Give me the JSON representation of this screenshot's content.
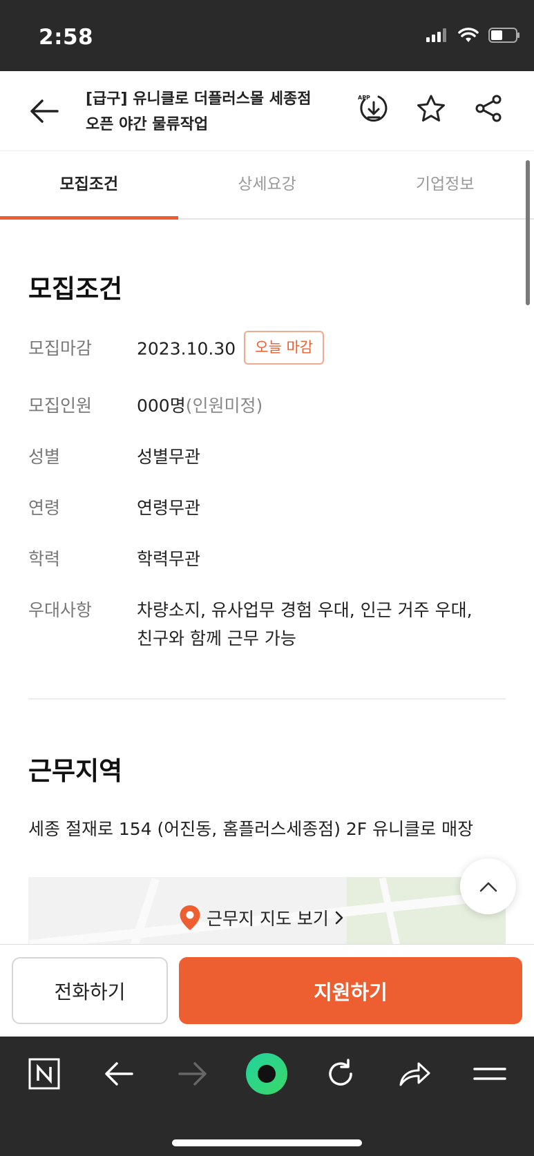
{
  "status_bar": {
    "time": "2:58"
  },
  "header": {
    "title_line1": "[급구] 유니클로 더플러스몰 세종점",
    "title_line2": "오픈 야간 물류작업",
    "app_badge": "APP"
  },
  "tabs": [
    {
      "label": "모집조건",
      "active": true
    },
    {
      "label": "상세요강",
      "active": false
    },
    {
      "label": "기업정보",
      "active": false
    }
  ],
  "recruit": {
    "title": "모집조건",
    "rows": {
      "deadline": {
        "label": "모집마감",
        "value": "2023.10.30",
        "badge": "오늘 마감"
      },
      "headcount": {
        "label": "모집인원",
        "value": "000명",
        "note": "(인원미정)"
      },
      "gender": {
        "label": "성별",
        "value": "성별무관"
      },
      "age": {
        "label": "연령",
        "value": "연령무관"
      },
      "education": {
        "label": "학력",
        "value": "학력무관"
      },
      "preference": {
        "label": "우대사항",
        "value_line1": "차량소지, 유사업무 경험 우대, 인근 거주 우대,",
        "value_line2": "친구와 함께 근무 가능"
      }
    }
  },
  "location": {
    "title": "근무지역",
    "address": "세종 절재로 154 (어진동, 홈플러스세종점) 2F 유니클로 매장",
    "map_link": "근무지 지도 보기"
  },
  "actions": {
    "call": "전화하기",
    "apply": "지원하기"
  },
  "colors": {
    "accent": "#ed5e31",
    "dark_bar": "#2a2a2a",
    "label_gray": "#777777"
  },
  "browser_icons": [
    "naver-n-icon",
    "back-arrow-icon",
    "forward-arrow-icon",
    "green-dot-icon",
    "refresh-icon",
    "share-icon",
    "menu-icon"
  ]
}
